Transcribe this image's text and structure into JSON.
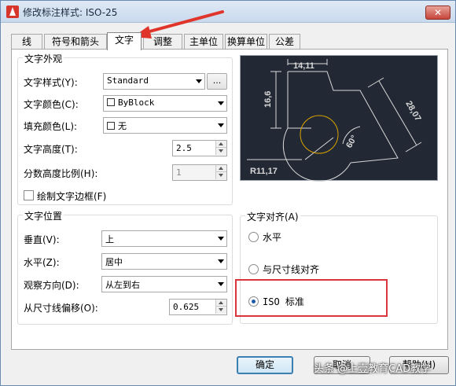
{
  "window": {
    "title": "修改标注样式: ISO-25",
    "close_glyph": "✕"
  },
  "tabs": [
    "线",
    "符号和箭头",
    "文字",
    "调整",
    "主单位",
    "换算单位",
    "公差"
  ],
  "active_tab": "文字",
  "text_appearance": {
    "group_title": "文字外观",
    "style_label": "文字样式(Y):",
    "style_value": "Standard",
    "style_browse_label": "...",
    "color_label": "文字颜色(C):",
    "color_value": "ByBlock",
    "fill_label": "填充颜色(L):",
    "fill_value": "无",
    "height_label": "文字高度(T):",
    "height_value": "2.5",
    "fraction_label": "分数高度比例(H):",
    "fraction_value": "1",
    "frame_label": "绘制文字边框(F)"
  },
  "preview": {
    "dim_top": "14,11",
    "dim_left": "16,6",
    "dim_diag": "28,07",
    "dim_angle": "60°",
    "dim_radius": "R11,17",
    "bg_color": "#222834",
    "fg_color": "#d8d8d8",
    "circle_color": "#d9a400"
  },
  "text_placement": {
    "group_title": "文字位置",
    "vertical_label": "垂直(V):",
    "vertical_value": "上",
    "horizontal_label": "水平(Z):",
    "horizontal_value": "居中",
    "direction_label": "观察方向(D):",
    "direction_value": "从左到右",
    "offset_label": "从尺寸线偏移(O):",
    "offset_value": "0.625"
  },
  "text_alignment": {
    "group_title": "文字对齐(A)",
    "options": [
      "水平",
      "与尺寸线对齐",
      "ISO 标准"
    ],
    "selected": "ISO 标准"
  },
  "buttons": {
    "ok": "确定",
    "cancel": "取消",
    "help": "帮助(H)"
  },
  "watermark": "头条 @上壹教育CAD教学",
  "colors": {
    "highlight_red": "#d9363e",
    "arrow_red": "#e0352b",
    "accent_blue": "#3c7fb1"
  }
}
